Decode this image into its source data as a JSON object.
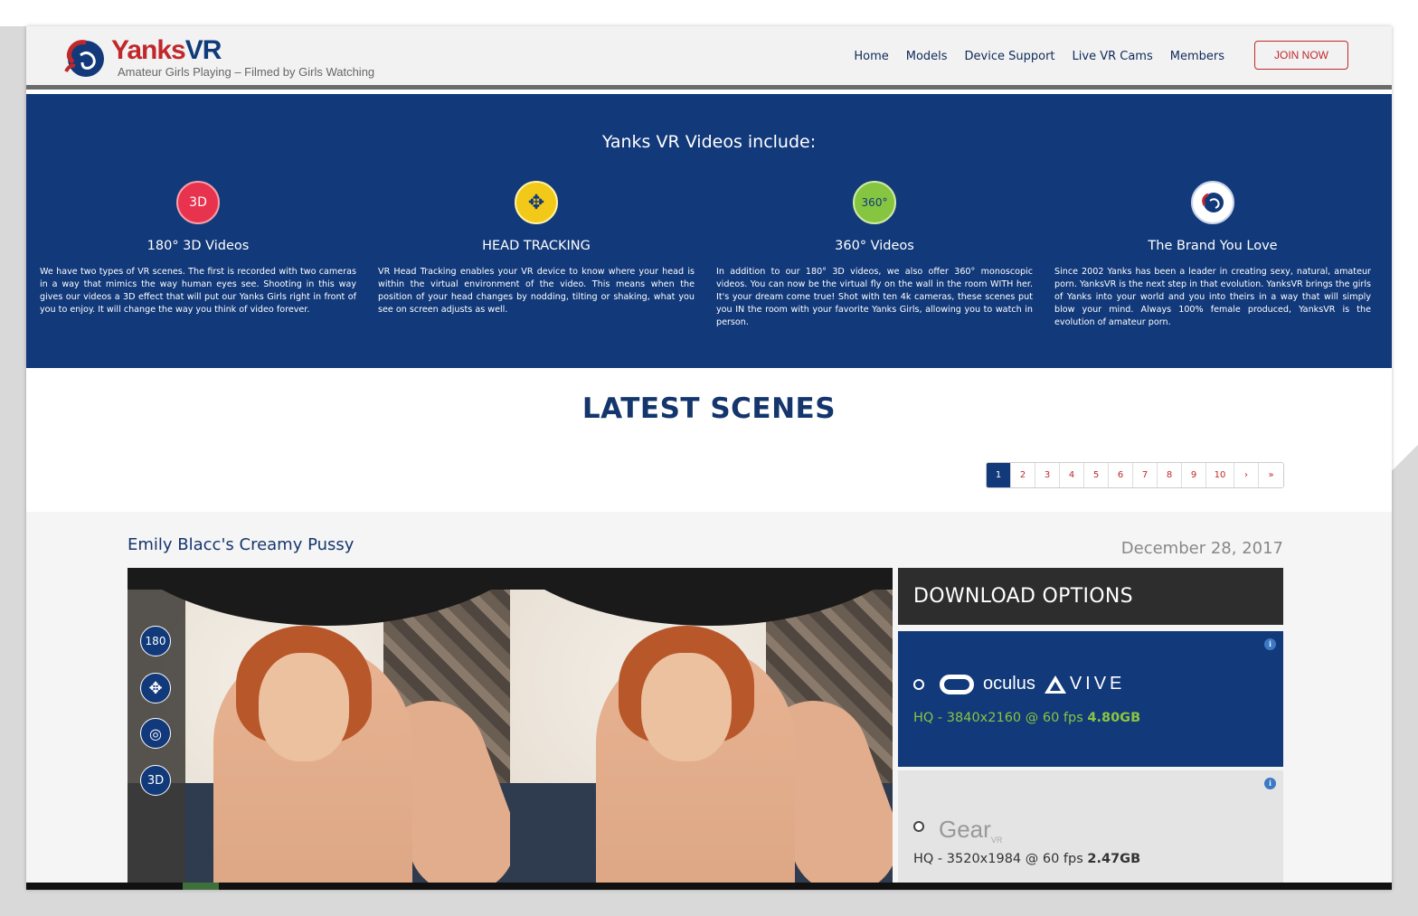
{
  "header": {
    "brand_main": "Yanks",
    "brand_vr": "VR",
    "tagline": "Amateur Girls Playing – Filmed by Girls Watching",
    "nav": [
      "Home",
      "Models",
      "Device Support",
      "Live VR Cams",
      "Members"
    ],
    "join_label": "JOIN NOW"
  },
  "features": {
    "title": "Yanks VR Videos include:",
    "items": [
      {
        "icon": "3d-icon",
        "icon_text": "3D",
        "color": "#e8334f",
        "title": "180° 3D Videos",
        "text": "We have two types of VR scenes. The first is recorded with two cameras in a way that mimics the way human eyes see. Shooting in this way gives our videos a 3D effect that will put our Yanks Girls right in front of you to enjoy. It will change the way you think of video forever."
      },
      {
        "icon": "head-tracking-icon",
        "icon_text": "✥",
        "color": "#f2c919",
        "title": "HEAD TRACKING",
        "text": "VR Head Tracking enables your VR device to know where your head is within the virtual environment of the video. This means when the position of your head changes by nodding, tilting or shaking, what you see on screen adjusts as well."
      },
      {
        "icon": "360-icon",
        "icon_text": "360°",
        "color": "#86c540",
        "title": "360° Videos",
        "text": "In addition to our 180° 3D videos, we also offer 360° monoscopic videos. You can now be the virtual fly on the wall in the room WITH her. It's your dream come true! Shot with ten 4k cameras, these scenes put you IN the room with your favorite Yanks Girls, allowing you to watch in person."
      },
      {
        "icon": "brand-logo-icon",
        "icon_text": "",
        "color": "#ffffff",
        "title": "The Brand You Love",
        "text": "Since 2002 Yanks has been a leader in creating sexy, natural, amateur porn. YanksVR is the next step in that evolution. YanksVR brings the girls of Yanks into your world and you into theirs in a way that will simply blow your mind. Always 100% female produced, YanksVR is the evolution of amateur porn."
      }
    ]
  },
  "latest": {
    "title": "LATEST SCENES",
    "pages": [
      "1",
      "2",
      "3",
      "4",
      "5",
      "6",
      "7",
      "8",
      "9",
      "10",
      "›",
      "»"
    ],
    "active_page": "1"
  },
  "scene": {
    "title": "Emily Blacc's Creamy Pussy",
    "date": "December 28, 2017",
    "controls": [
      "180",
      "✥",
      "◎",
      "3D"
    ]
  },
  "download": {
    "heading": "DOWNLOAD OPTIONS",
    "option1": {
      "brand_a": "oculus",
      "brand_b": "VIVE",
      "quality": "HQ - 3840x2160 @ 60 fps",
      "size": "4.80GB"
    },
    "option2": {
      "brand": "Gear",
      "brand_sub": "VR",
      "quality": "HQ - 3520x1984 @ 60 fps",
      "size": "2.47GB"
    },
    "info_glyph": "i"
  }
}
